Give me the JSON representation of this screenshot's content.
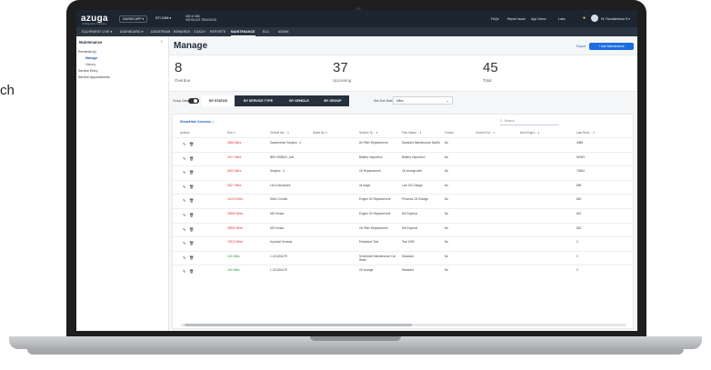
{
  "outside": {
    "partial_text": "ch"
  },
  "topbar": {
    "logo": "azuga",
    "logo_sub": "A Bridgestone Company",
    "account_button": "DAVIDS APP ▾",
    "vehicle_select": "DTI 1056 ▾",
    "vehicles_line1": "452 of 456",
    "vehicles_line2": "VEHICLES TRACKING",
    "links": [
      "FAQs",
      "Report Issue",
      "App Demo",
      "Labs"
    ],
    "user": "Hi, Ramakrishna S ▾"
  },
  "nav": {
    "items": [
      "EQUIPMENT LIVE ▾",
      "DASHBOARD ▾",
      "DATATREAM",
      "REWARDS",
      "COACH",
      "REPORTS",
      "MAINTENANCE",
      "ELD",
      "ADMIN"
    ],
    "active": "MAINTENANCE"
  },
  "sidebar": {
    "title": "Maintenance",
    "collapse_icon": "‹",
    "items": [
      {
        "label": "Reminder(s)",
        "type": "section"
      },
      {
        "label": "Manage",
        "type": "active"
      },
      {
        "label": "History",
        "type": "sub"
      },
      {
        "label": "Service Entry",
        "type": "section"
      },
      {
        "label": "Service Appointments",
        "type": "section"
      }
    ]
  },
  "main": {
    "title": "Manage",
    "export": "Export",
    "add_button": "+ Add Maintenance",
    "stats": [
      {
        "value": "8",
        "label": "Overdue"
      },
      {
        "value": "37",
        "label": "Upcoming"
      },
      {
        "value": "45",
        "label": "Total"
      }
    ],
    "group_data_label": "Group Data",
    "tabs": [
      "BY STATUS",
      "BY SERVICE TYPE",
      "BY VEHICLE",
      "BY GROUP"
    ],
    "active_tab": "BY STATUS",
    "due_date_label": "See Due Date In",
    "due_date_value": "Miles",
    "show_hide": "Show/Hide Columns ⌵",
    "search_placeholder": "Search",
    "columns": [
      "Actions",
      "Due ⇕",
      "Vehicle Na... ⇕",
      "Asset No ⇕",
      "Service Ty... ⇕",
      "Plan Name... ⇕",
      "Closed",
      "Current Od... ⇕",
      "Next Engin... ⇕",
      "Last Servi... ⇕"
    ],
    "rows": [
      {
        "due": "2848 Miles",
        "status": "red",
        "vehicle": "Sacramento Hospice - 2",
        "service": "Air Filter Replacement",
        "plan": "Standard Maintenance Nat06",
        "closed": "No",
        "last": "4088"
      },
      {
        "due": "240+ Miles",
        "status": "red",
        "vehicle": "BEE MOBILE_test",
        "service": "Battery Inspection",
        "plan": "Battery Inspection",
        "closed": "No",
        "last": "51983"
      },
      {
        "due": "5813 Miles",
        "status": "red",
        "vehicle": "Hospice - 3",
        "service": "Oil Replacement",
        "plan": "Oil change alert",
        "closed": "No",
        "last": "75484"
      },
      {
        "due": "630+ Miles",
        "status": "red",
        "vehicle": "Leo's Mercedes",
        "service": "oil range",
        "plan": "Low Oil Change",
        "closed": "No",
        "last": "896"
      },
      {
        "due": "11200 Miles",
        "status": "red",
        "vehicle": "Silver Corolla",
        "service": "Engine Oil Replacement",
        "plan": "Princess Oil Change",
        "closed": "No",
        "last": "800"
      },
      {
        "due": "28369 Miles",
        "status": "red",
        "vehicle": "MS Honda",
        "service": "Engine Oil Replacement",
        "plan": "MS Equinox",
        "closed": "No",
        "last": "842"
      },
      {
        "due": "28369 Miles",
        "status": "red",
        "vehicle": "MS Honda",
        "service": "Oil Filter Replacement",
        "plan": "MS Equinox",
        "closed": "No",
        "last": "842"
      },
      {
        "due": "78212 Miles",
        "status": "red",
        "vehicle": "Hyundai Genesis",
        "service": "Emissions Test",
        "plan": "Test 1050",
        "closed": "No",
        "last": "0"
      },
      {
        "due": "150 Miles",
        "status": "green",
        "vehicle": "1.12L80147E",
        "service": "Scheduled Maintenance Car Wash",
        "plan": "Standard",
        "closed": "No",
        "last": "0"
      },
      {
        "due": "150 Miles",
        "status": "green",
        "vehicle": "1.12L80147E",
        "service": "Oil change",
        "plan": "Standard",
        "closed": "No",
        "last": "0"
      }
    ]
  },
  "colors": {
    "accent": "#1a6fe0",
    "overdue": "#e53935",
    "upcoming": "#2e9e3e",
    "topbar": "#1c2530"
  }
}
